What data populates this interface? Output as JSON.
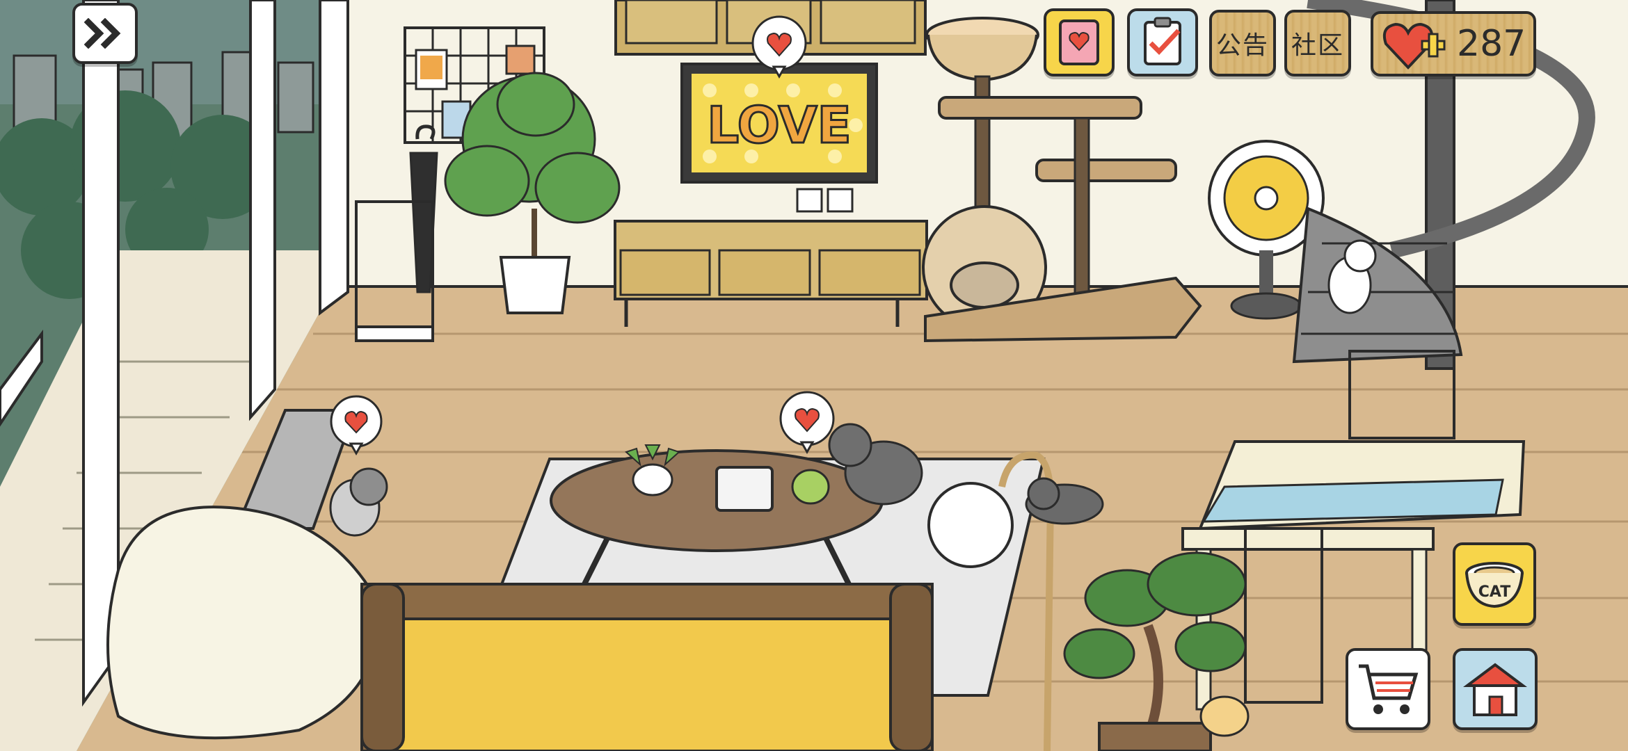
{
  "scene": {
    "tv_text": "LOVE",
    "colors": {
      "floor": "#d8b98f",
      "wall": "#f6f3e6",
      "sofa_yellow": "#f2c94c",
      "heart_red": "#e8503f",
      "button_yellow": "#f7d54a",
      "button_blue": "#bcdcea",
      "wood_button": "#d6b572"
    }
  },
  "top_bar": {
    "expand_icon": "double-chevron-right-icon",
    "diary_icon": "cat-diary-book-icon",
    "checklist_icon": "clipboard-check-icon",
    "notice_label": "公告",
    "community_label": "社区",
    "heart_count": "287"
  },
  "right_bar": {
    "food_bowl_icon": "cat-food-bowl-icon",
    "food_bowl_text": "CAT",
    "shop_icon": "shopping-cart-icon",
    "yard_icon": "house-icon"
  }
}
